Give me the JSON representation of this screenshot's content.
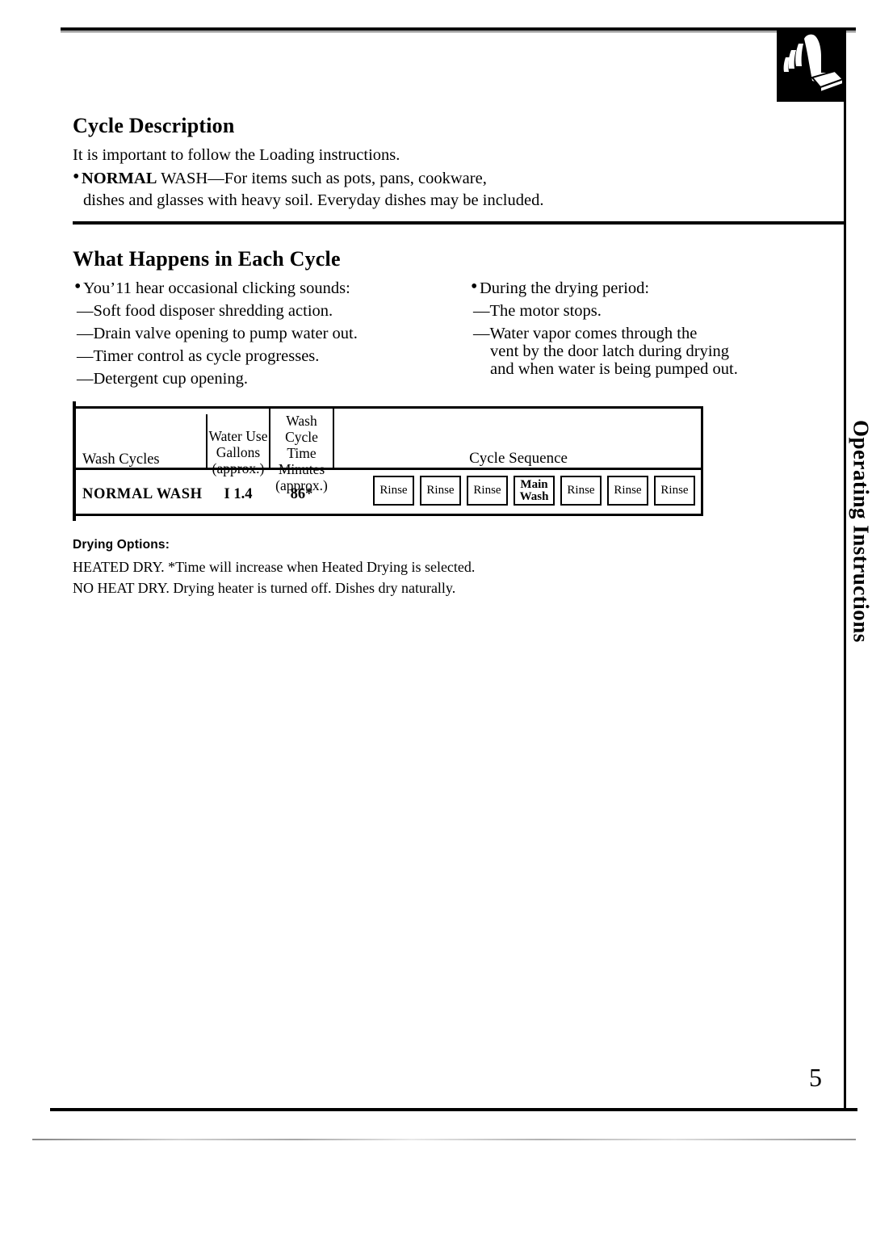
{
  "page": {
    "number": "5",
    "side_tab_label": "Operating Instructions",
    "tab_icon": "hand-pressing-button-icon"
  },
  "cycle_description": {
    "title": "Cycle Description",
    "intro": "It is important to follow the Loading instructions.",
    "bullet": {
      "name": "NORMAL",
      "line1_rest": " WASH—For items such as pots, pans, cookware,",
      "line2": "dishes and glasses with heavy soil. Everyday dishes may be included."
    }
  },
  "what_happens": {
    "title": "What Happens in Each Cycle",
    "left_column": {
      "bullet": "You’11 hear occasional clicking sounds:",
      "items": [
        "—Soft food disposer shredding action.",
        "—Drain valve opening to pump water out.",
        "—Timer control as cycle progresses.",
        "—Detergent cup opening."
      ]
    },
    "right_column": {
      "bullet": "During the drying period:",
      "items": [
        "—The motor stops.",
        "—Water vapor comes through the",
        "vent by the door latch during drying",
        "and when water is being pumped out."
      ]
    }
  },
  "table": {
    "headers": {
      "wash_cycles": "Wash Cycles",
      "water_use": "Water Use\nGallons\n(approx.)",
      "water_use_l1": "Water Use",
      "water_use_l2": "Gallons",
      "water_use_l3": "(approx.)",
      "wash_time_l1": "Wash Cycle",
      "wash_time_l2": "Time",
      "wash_time_l3": "Minutes",
      "wash_time_l4": "(approx.)",
      "cycle_sequence": "Cycle Sequence"
    },
    "rows": [
      {
        "name": "NORMAL   WASH",
        "water_use_gallons": "I 1.4",
        "wash_cycle_minutes": "86*",
        "sequence": [
          "Rinse",
          "Rinse",
          "Rinse",
          "Main Wash",
          "Rinse",
          "Rinse",
          "Rinse"
        ]
      }
    ]
  },
  "drying_options": {
    "title": "Drying Options:",
    "lines": [
      "HEATED DRY. *Time will increase when Heated Drying is selected.",
      "NO HEAT DRY. Drying heater is turned off. Dishes dry naturally."
    ]
  },
  "colors": {
    "ink": "#000000",
    "paper": "#ffffff"
  }
}
